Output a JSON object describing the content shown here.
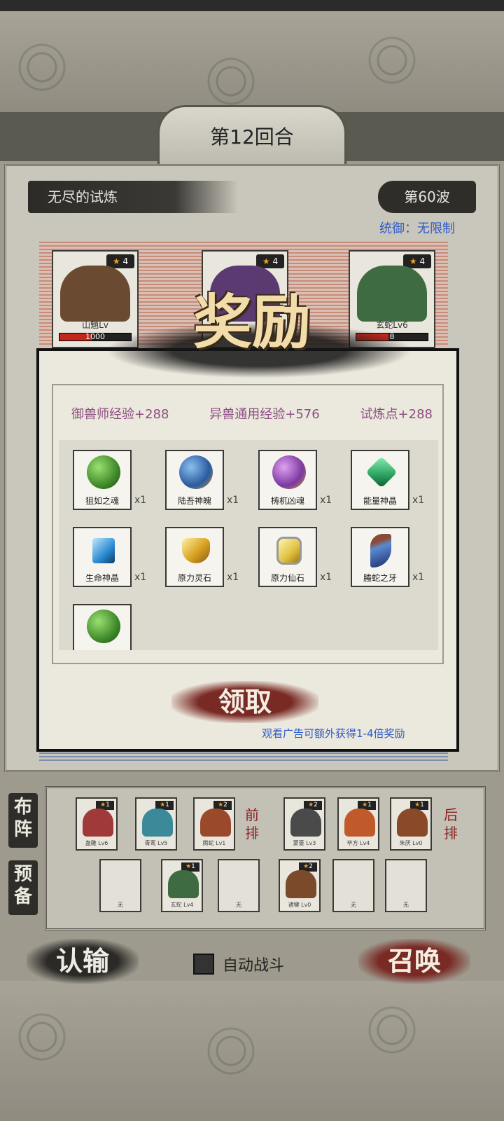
{
  "header": {
    "round_label": "第12回合"
  },
  "battle": {
    "trial_name": "无尽的试炼",
    "wave_label": "第60波",
    "control_label": "统御：无限制",
    "enemies": [
      {
        "stars": "4",
        "name": "山魈Lv",
        "hp_text": "1000",
        "color": "#6b4a32"
      },
      {
        "stars": "4",
        "name": "",
        "hp_text": "",
        "color": "#5a3a70"
      },
      {
        "stars": "4",
        "name": "玄蛇Lv6",
        "hp_text": "8",
        "color": "#3e6b40"
      }
    ]
  },
  "reward_dialog": {
    "title": "奖励",
    "exp": {
      "master_exp": "御兽师经验+288",
      "beast_exp": "异兽通用经验+576",
      "trial_points": "试炼点+288"
    },
    "items": [
      {
        "name": "狙如之魂",
        "count": "x1",
        "color": "#3f8a2a"
      },
      {
        "name": "陆吾神魄",
        "count": "x1",
        "color": "#2a5aa0"
      },
      {
        "name": "梼杌凶魂",
        "count": "x1",
        "color": "#7a3aa0"
      },
      {
        "name": "能量神晶",
        "count": "x1",
        "color": "#2aa060"
      },
      {
        "name": "生命神晶",
        "count": "x1",
        "color": "#2a8ad0"
      },
      {
        "name": "原力灵石",
        "count": "x1",
        "color": "#d8a020"
      },
      {
        "name": "原力仙石",
        "count": "x1",
        "color": "#e0c040"
      },
      {
        "name": "螣蛇之牙",
        "count": "x1",
        "color": "#3a5a9a"
      },
      {
        "name": "",
        "count": "",
        "color": "#3f8a2a"
      }
    ],
    "claim_label": "领取",
    "ad_hint": "观看广告可额外获得1-4倍奖励"
  },
  "formation": {
    "deploy_label": "布阵",
    "reserve_label": "预备",
    "front_label": "前排",
    "back_label": "后排",
    "front_units": [
      {
        "stars": "1",
        "name": "蛊雕 Lv6",
        "color": "#a03a3a"
      },
      {
        "stars": "1",
        "name": "青鸾 Lv5",
        "color": "#3a8a9a"
      },
      {
        "stars": "2",
        "name": "腾蛇 Lv1",
        "color": "#9a4a2a"
      }
    ],
    "back_units": [
      {
        "stars": "2",
        "name": "蒙豪 Lv3",
        "color": "#4a4a4a"
      },
      {
        "stars": "1",
        "name": "毕方 Lv4",
        "color": "#c05a2a"
      },
      {
        "stars": "1",
        "name": "朱厌 Lv0",
        "color": "#8a4a2a"
      }
    ],
    "reserve_units": [
      {
        "stars": "",
        "name": "无",
        "color": ""
      },
      {
        "stars": "1",
        "name": "玄蛇 Lv4",
        "color": "#3e6b40"
      },
      {
        "stars": "",
        "name": "无",
        "color": ""
      },
      {
        "stars": "2",
        "name": "诸犍 Lv0",
        "color": "#7a4a2a"
      },
      {
        "stars": "",
        "name": "无",
        "color": ""
      },
      {
        "stars": "",
        "name": "无",
        "color": ""
      }
    ]
  },
  "controls": {
    "surrender_label": "认输",
    "auto_battle_label": "自动战斗",
    "summon_label": "召唤"
  }
}
